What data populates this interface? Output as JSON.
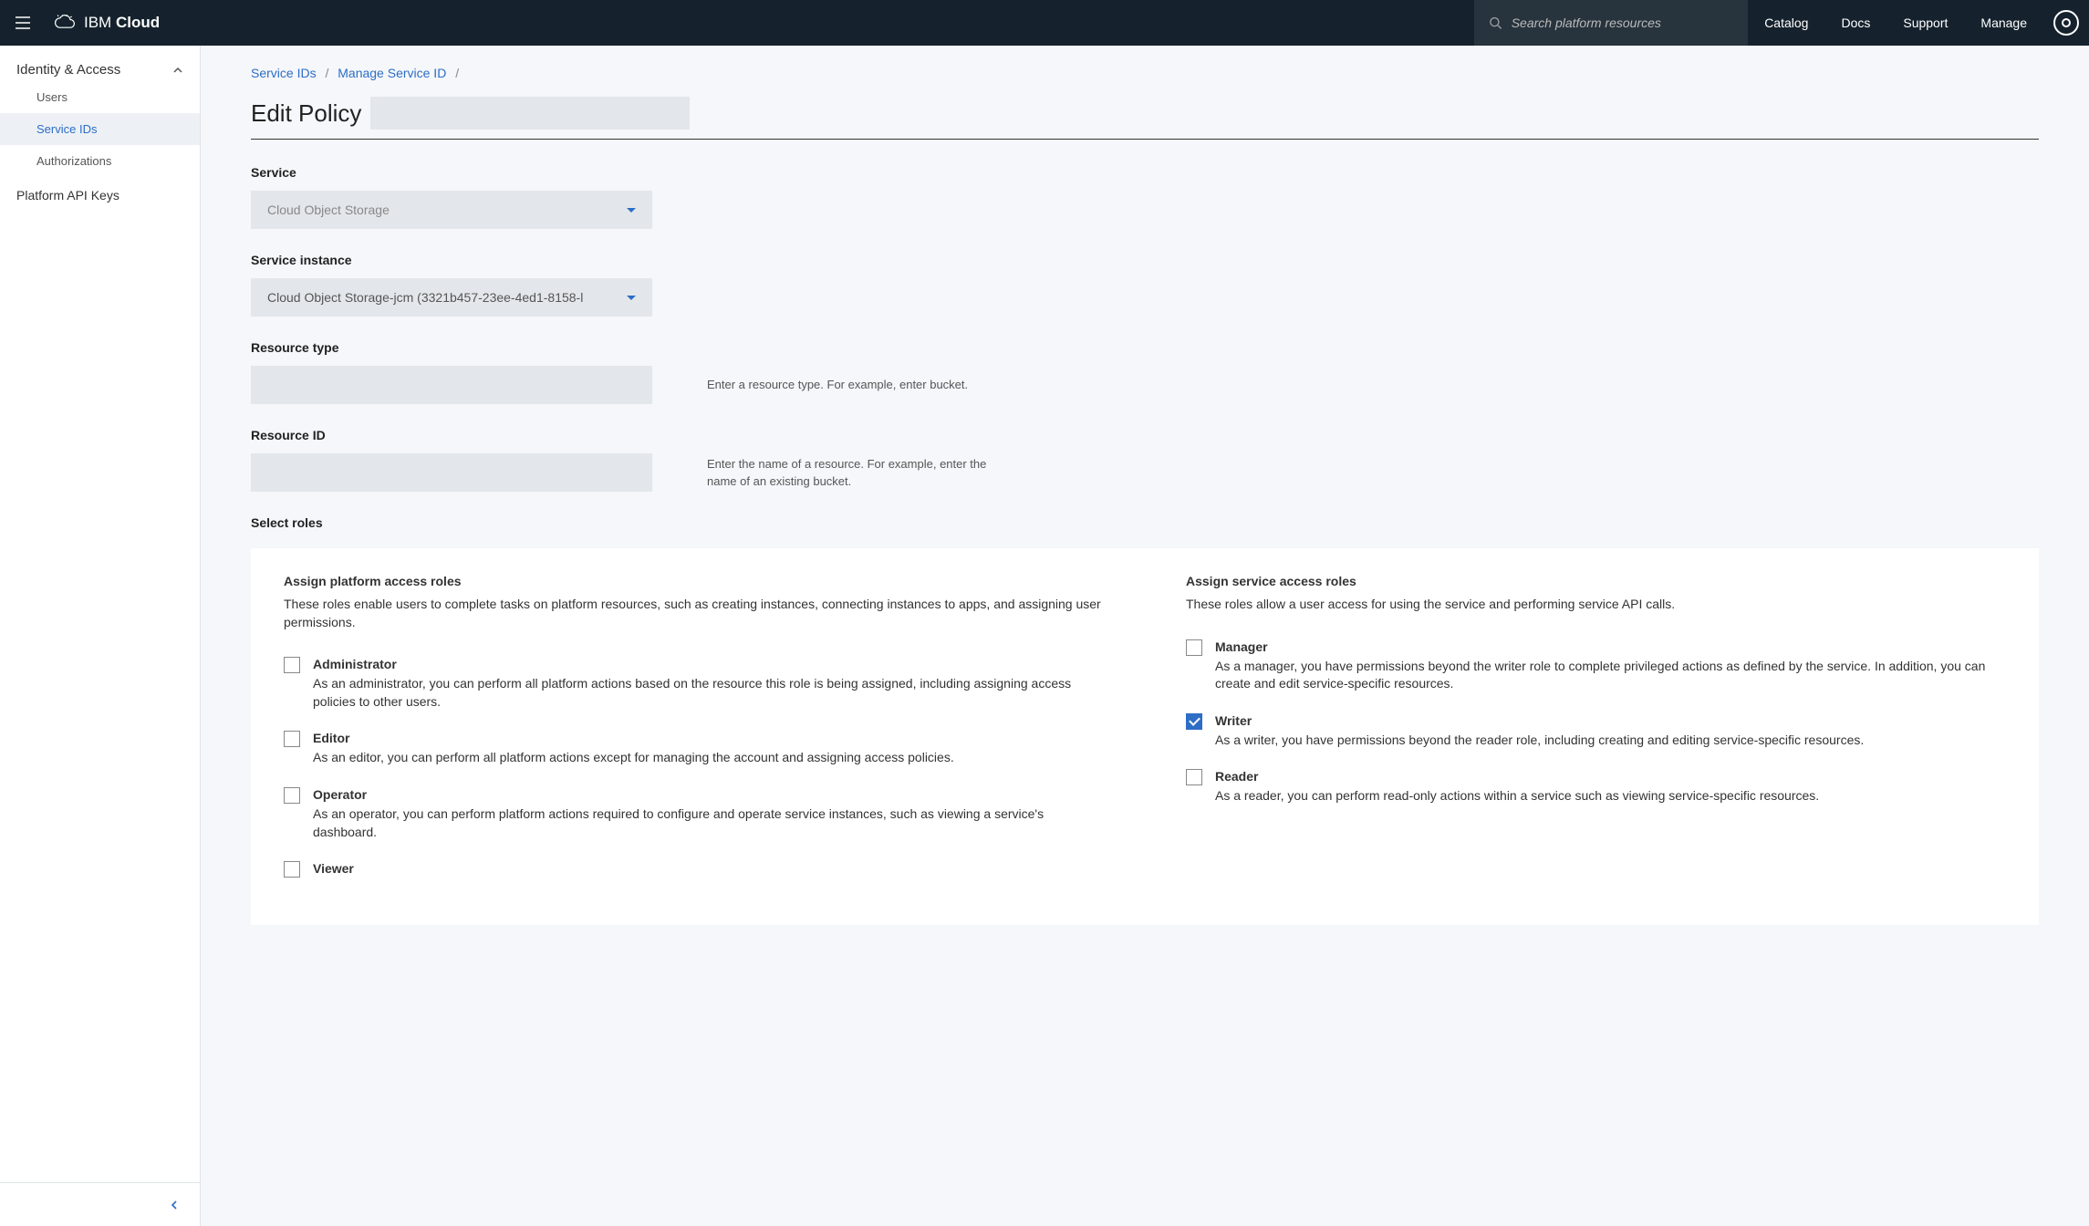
{
  "header": {
    "brand_prefix": "IBM",
    "brand_suffix": "Cloud",
    "search_placeholder": "Search platform resources",
    "nav": [
      "Catalog",
      "Docs",
      "Support",
      "Manage"
    ]
  },
  "sidebar": {
    "section_label": "Identity & Access",
    "items": [
      {
        "label": "Users",
        "active": false
      },
      {
        "label": "Service IDs",
        "active": true
      },
      {
        "label": "Authorizations",
        "active": false
      }
    ],
    "top_items": [
      "Platform API Keys"
    ]
  },
  "breadcrumb": {
    "items": [
      "Service IDs",
      "Manage Service ID"
    ]
  },
  "page_title": "Edit Policy",
  "fields": {
    "service": {
      "label": "Service",
      "value": "Cloud Object Storage"
    },
    "service_instance": {
      "label": "Service instance",
      "value": "Cloud Object Storage-jcm (3321b457-23ee-4ed1-8158-l"
    },
    "resource_type": {
      "label": "Resource type",
      "value": "",
      "hint": "Enter a resource type. For example, enter bucket."
    },
    "resource_id": {
      "label": "Resource ID",
      "value": "",
      "hint": "Enter the name of a resource. For example, enter the name of an existing bucket."
    }
  },
  "roles": {
    "section_label": "Select roles",
    "platform": {
      "title": "Assign platform access roles",
      "desc": "These roles enable users to complete tasks on platform resources, such as creating instances, connecting instances to apps, and assigning user permissions.",
      "items": [
        {
          "name": "Administrator",
          "checked": false,
          "desc": "As an administrator, you can perform all platform actions based on the resource this role is being assigned, including assigning access policies to other users."
        },
        {
          "name": "Editor",
          "checked": false,
          "desc": "As an editor, you can perform all platform actions except for managing the account and assigning access policies."
        },
        {
          "name": "Operator",
          "checked": false,
          "desc": "As an operator, you can perform platform actions required to configure and operate service instances, such as viewing a service's dashboard."
        },
        {
          "name": "Viewer",
          "checked": false,
          "desc": ""
        }
      ]
    },
    "service_roles": {
      "title": "Assign service access roles",
      "desc": "These roles allow a user access for using the service and performing service API calls.",
      "items": [
        {
          "name": "Manager",
          "checked": false,
          "desc": "As a manager, you have permissions beyond the writer role to complete privileged actions as defined by the service. In addition, you can create and edit service-specific resources."
        },
        {
          "name": "Writer",
          "checked": true,
          "desc": "As a writer, you have permissions beyond the reader role, including creating and editing service-specific resources."
        },
        {
          "name": "Reader",
          "checked": false,
          "desc": "As a reader, you can perform read-only actions within a service such as viewing service-specific resources."
        }
      ]
    }
  }
}
